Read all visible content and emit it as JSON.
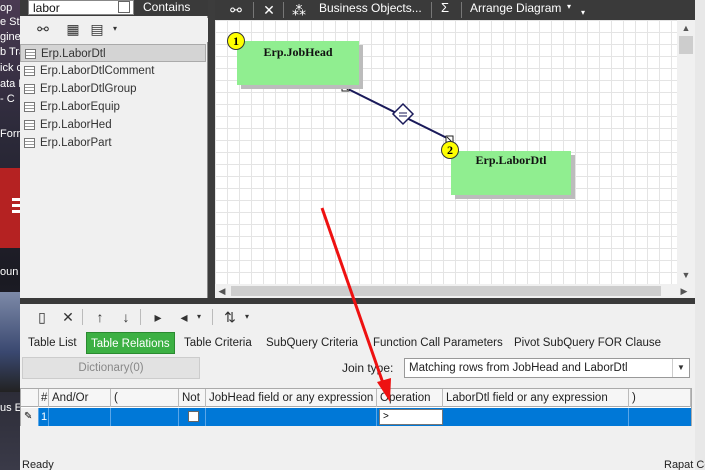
{
  "desktop": {
    "left_fragments": [
      "op",
      "e Sta",
      "gine",
      "b Tra",
      "ick c",
      "ata D",
      "- C"
    ],
    "form_label": "Forr",
    "round_label": "oun",
    "bus_label": "us E"
  },
  "tree": {
    "search_value": "labor",
    "contains_label": "Contains",
    "items": [
      {
        "label": "Erp.LaborDtl"
      },
      {
        "label": "Erp.LaborDtlComment"
      },
      {
        "label": "Erp.LaborDtlGroup"
      },
      {
        "label": "Erp.LaborEquip"
      },
      {
        "label": "Erp.LaborHed"
      },
      {
        "label": "Erp.LaborPart"
      }
    ]
  },
  "diagram_toolbar": {
    "business_objects_label": "Business Objects...",
    "sigma_label": "Σ",
    "arrange_label": "Arrange Diagram"
  },
  "diagram": {
    "nodes": [
      {
        "badge": "1",
        "name": "Erp.JobHead"
      },
      {
        "badge": "2",
        "name": "Erp.LaborDtl"
      }
    ]
  },
  "tabs": [
    {
      "label": "Table List"
    },
    {
      "label": "Table Relations"
    },
    {
      "label": "Table Criteria"
    },
    {
      "label": "SubQuery Criteria"
    },
    {
      "label": "Function Call Parameters"
    },
    {
      "label": "Pivot SubQuery FOR Clause"
    }
  ],
  "relations": {
    "dictionary_button": "Dictionary(0)",
    "join_type_label": "Join type:",
    "join_type_value": "Matching rows from JobHead and LaborDtl"
  },
  "grid": {
    "columns": [
      "#",
      "And/Or",
      "(",
      "Not",
      "JobHead field or any expression",
      "Operation",
      "LaborDtl field or any expression",
      ")"
    ],
    "row": {
      "num": "1",
      "operation": ">"
    }
  },
  "status": {
    "left": "Ready",
    "right": "Rapat Co"
  },
  "colors": {
    "node_fill": "#90ee90",
    "badge_fill": "#ffff00",
    "active_tab": "#3cb043",
    "selected_row": "#0078d7",
    "annotation_arrow": "#ee1111"
  }
}
